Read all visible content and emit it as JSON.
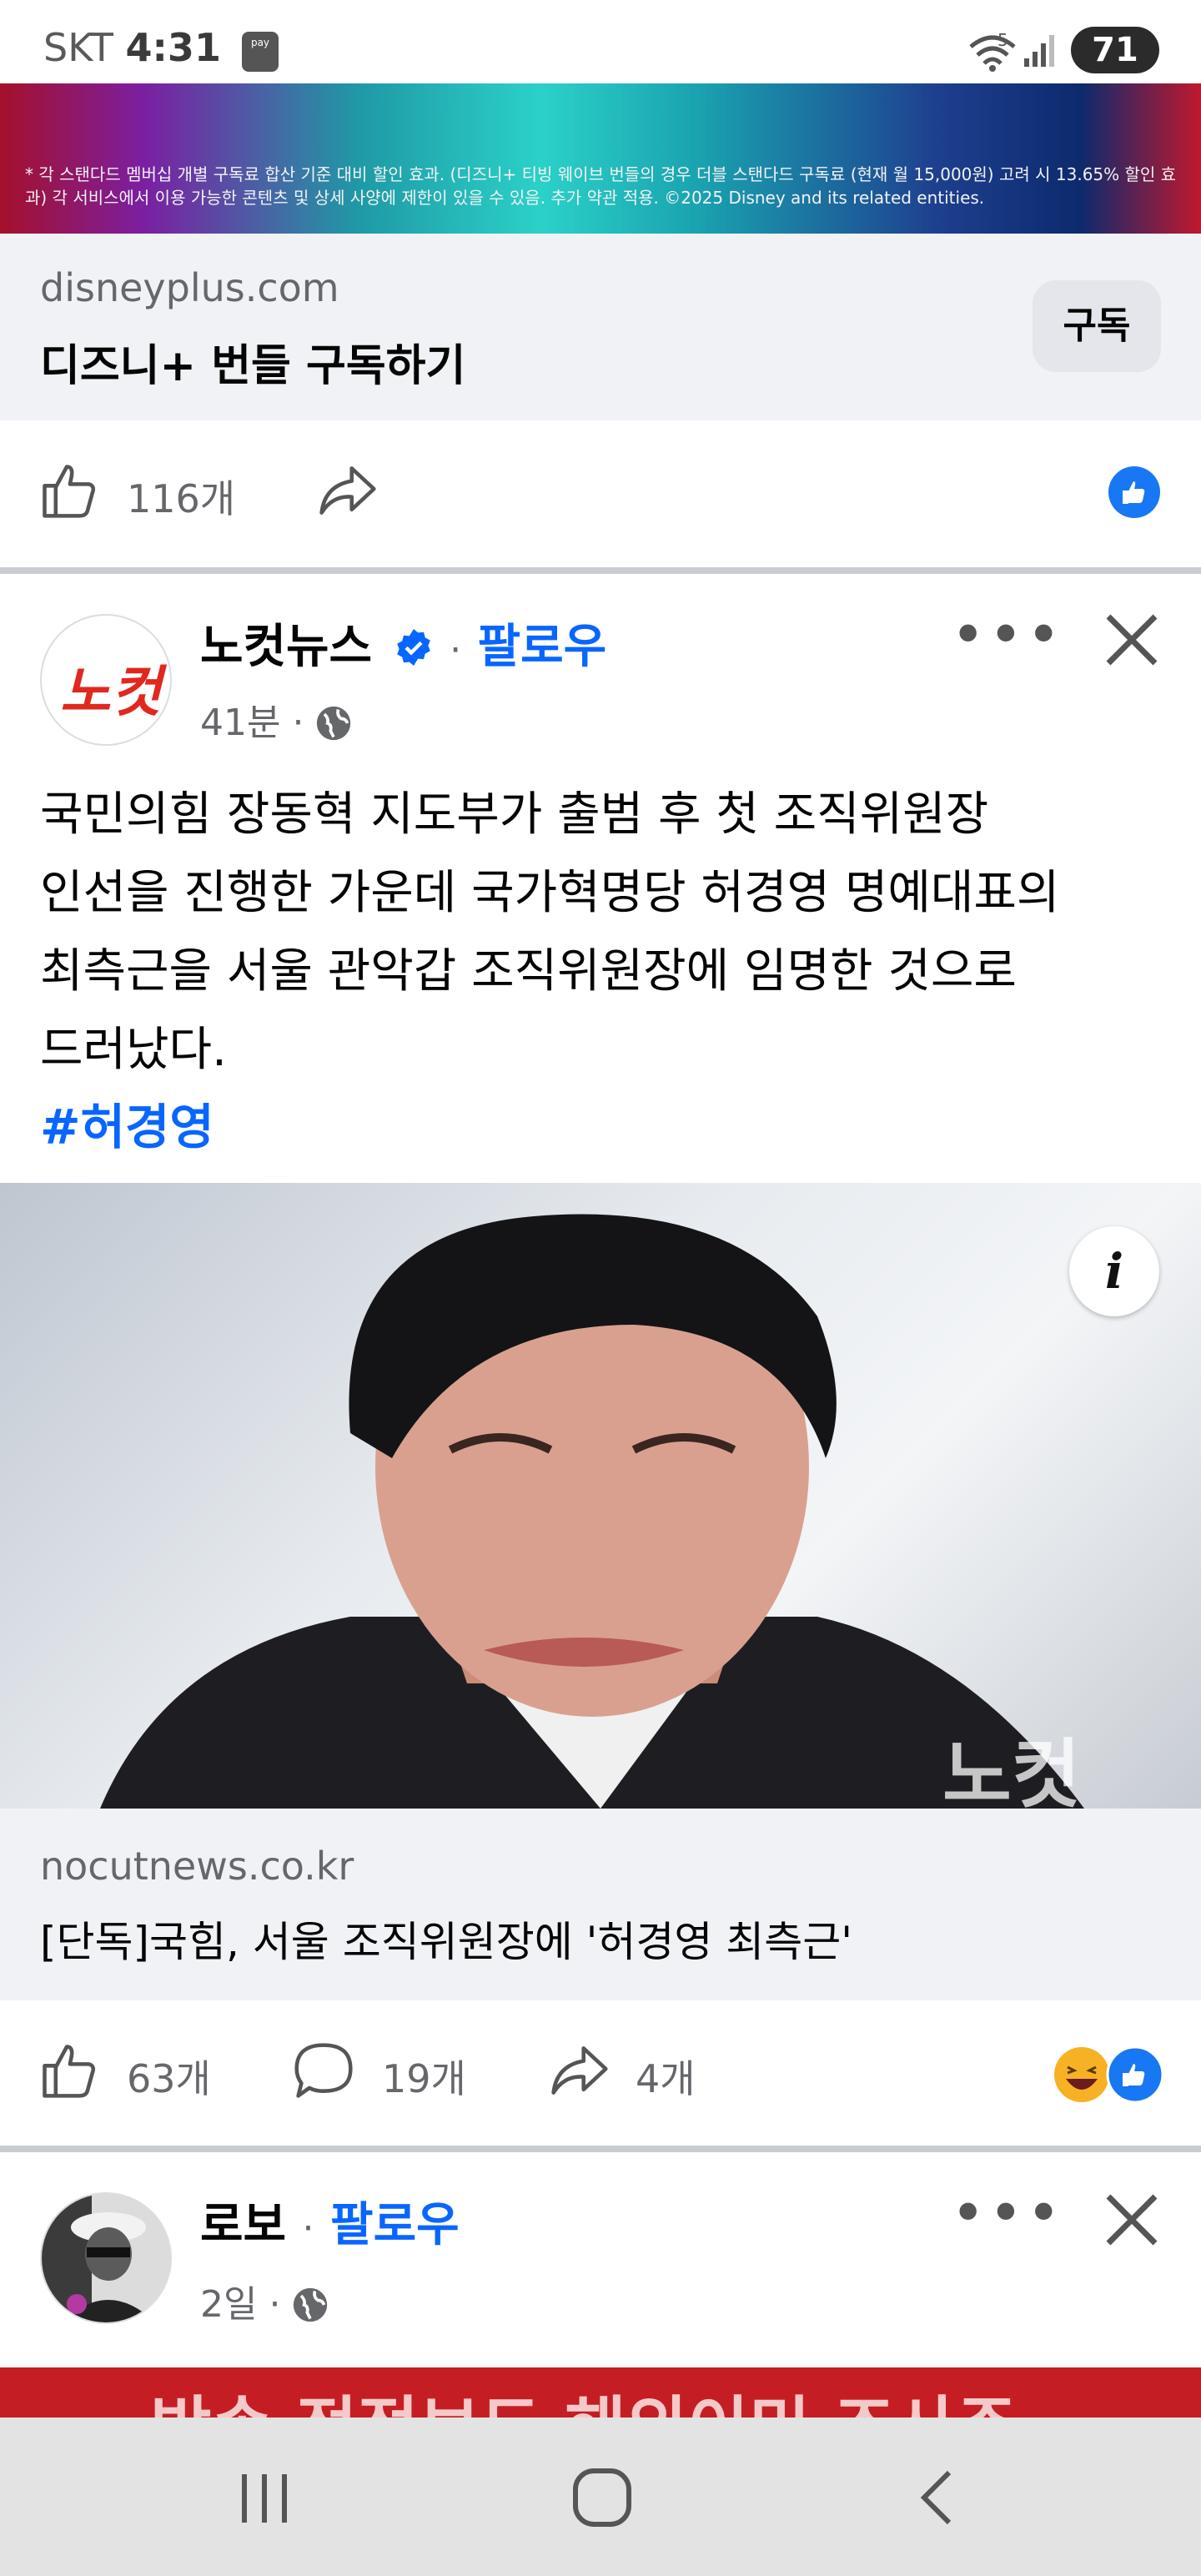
{
  "status_bar": {
    "carrier": "SKT",
    "time": "4:31",
    "pay_label": "pay",
    "network": "5",
    "battery": "71"
  },
  "ad": {
    "disclaimer": "* 각 스탠다드 멤버십 개별 구독료 합산 기준 대비 할인 효과. (디즈니+ 티빙 웨이브 번들의 경우 더블 스탠다드 구독료 (현재 월 15,000원) 고려 시 13.65% 할인 효과) 각 서비스에서 이용 가능한 콘텐츠 및 상세 사양에 제한이 있을 수 있음. 추가 약관 적용. ©2025 Disney and its related entities.",
    "domain": "disneyplus.com",
    "title": "디즈니+ 번들 구독하기",
    "subscribe_label": "구독",
    "like_count": "116개"
  },
  "post1": {
    "page_name": "노컷뉴스",
    "avatar_text": "노컷",
    "follow_label": "팔로우",
    "time": "41분",
    "text_lines": [
      "국민의힘 장동혁 지도부가 출범 후 첫 조직위원장",
      "인선을 진행한 가운데 국가혁명당 허경영 명예대표의",
      "최측근을 서울 관악갑 조직위원장에 임명한 것으로",
      "드러났다."
    ],
    "hashtag": "#허경영",
    "info_label": "i",
    "link_domain": "nocutnews.co.kr",
    "link_title": "[단독]국힘, 서울 조직위원장에 '허경영 최측근'",
    "watermark": "노컷",
    "like_count": "63개",
    "comment_count": "19개",
    "share_count": "4개"
  },
  "post2": {
    "page_name": "로보",
    "follow_label": "팔로우",
    "time": "2일",
    "banner_text": "방송 정정보도 해외이민 조사주"
  },
  "colors": {
    "brand_blue": "#0866ff",
    "nocut_red": "#e0281e",
    "divider": "#c9ccd1",
    "link_bg": "#f0f2f5"
  }
}
